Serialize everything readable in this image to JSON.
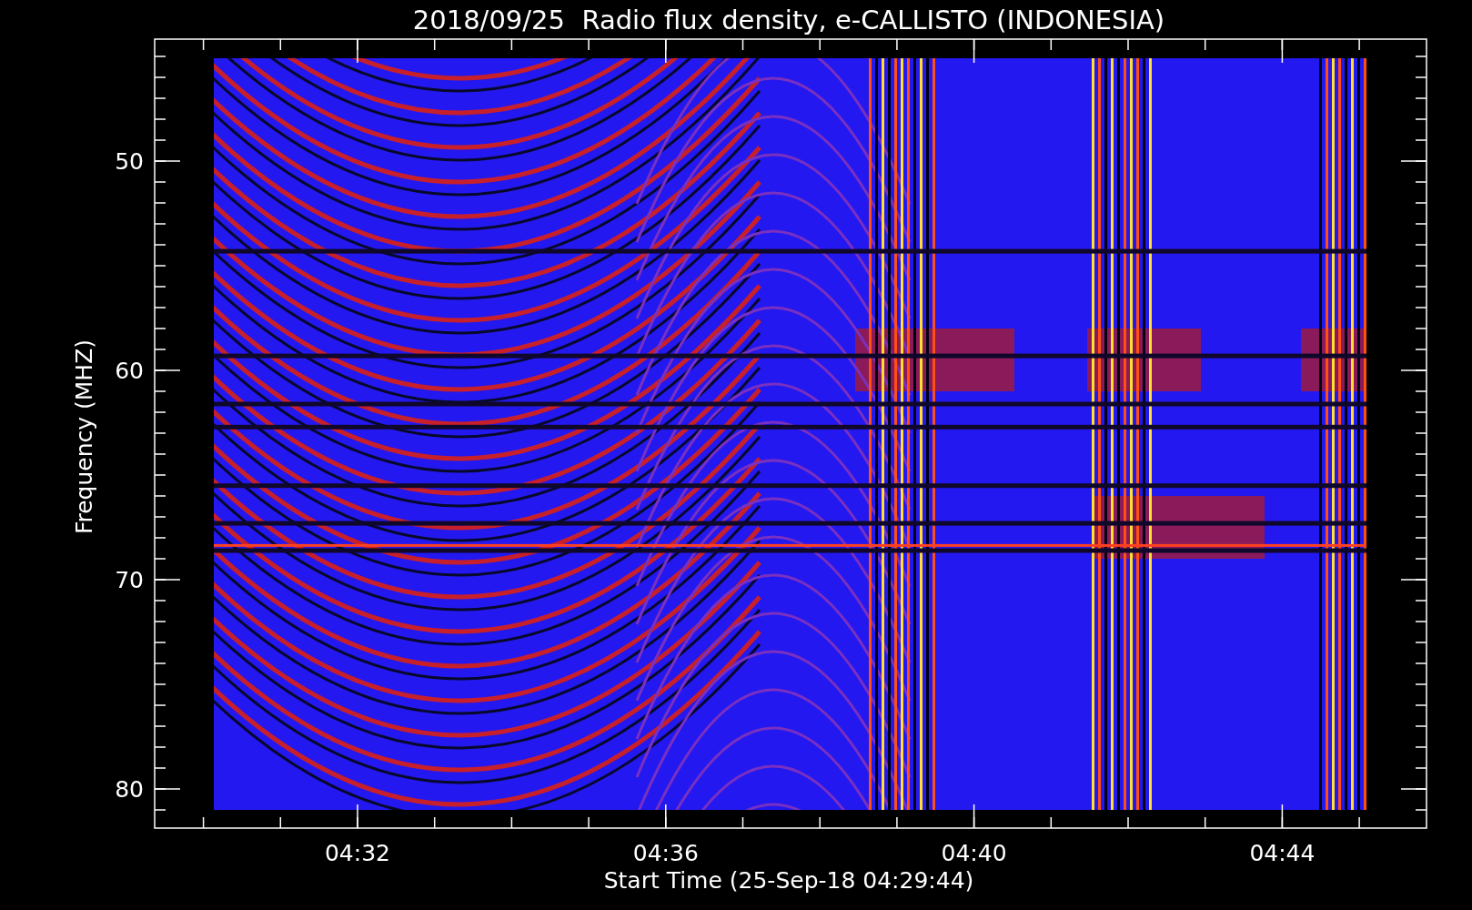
{
  "title": "2018/09/25  Radio flux density, e-CALLISTO (INDONESIA)",
  "x_axis": {
    "label": "Start Time (25-Sep-18 04:29:44)",
    "ticks": [
      "04:32",
      "04:36",
      "04:40",
      "04:44"
    ]
  },
  "y_axis": {
    "label": "Frequency (MHZ)",
    "ticks": [
      "50",
      "60",
      "70",
      "80"
    ]
  }
}
